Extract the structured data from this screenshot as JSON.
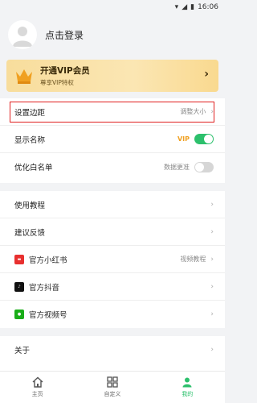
{
  "status_bar": {
    "time": "16:06"
  },
  "profile": {
    "login_text": "点击登录"
  },
  "vip": {
    "title": "开通VIP会员",
    "subtitle": "尊享VIP特权"
  },
  "group1": [
    {
      "label": "设置边距",
      "right_text": "调整大小",
      "highlighted": true
    },
    {
      "label": "显示名称",
      "tag": "VIP",
      "toggle": "on"
    },
    {
      "label": "优化白名单",
      "right_text": "数据更准",
      "toggle": "off"
    }
  ],
  "group2": [
    {
      "label": "使用教程"
    },
    {
      "label": "建议反馈"
    },
    {
      "label": "官方小红书",
      "right_text": "视频教程",
      "icon": "xiaohongshu-icon"
    },
    {
      "label": "官方抖音",
      "icon": "douyin-icon"
    },
    {
      "label": "官方视频号",
      "icon": "wechat-channels-icon"
    }
  ],
  "group3": [
    {
      "label": "关于"
    }
  ],
  "nav": [
    {
      "label": "主页",
      "icon": "home-icon",
      "active": false
    },
    {
      "label": "自定义",
      "icon": "grid-icon",
      "active": false
    },
    {
      "label": "我的",
      "icon": "person-icon",
      "active": true
    }
  ],
  "colors": {
    "accent": "#2cc06c",
    "highlight": "#e02020",
    "vip_tag": "#f0a020"
  }
}
